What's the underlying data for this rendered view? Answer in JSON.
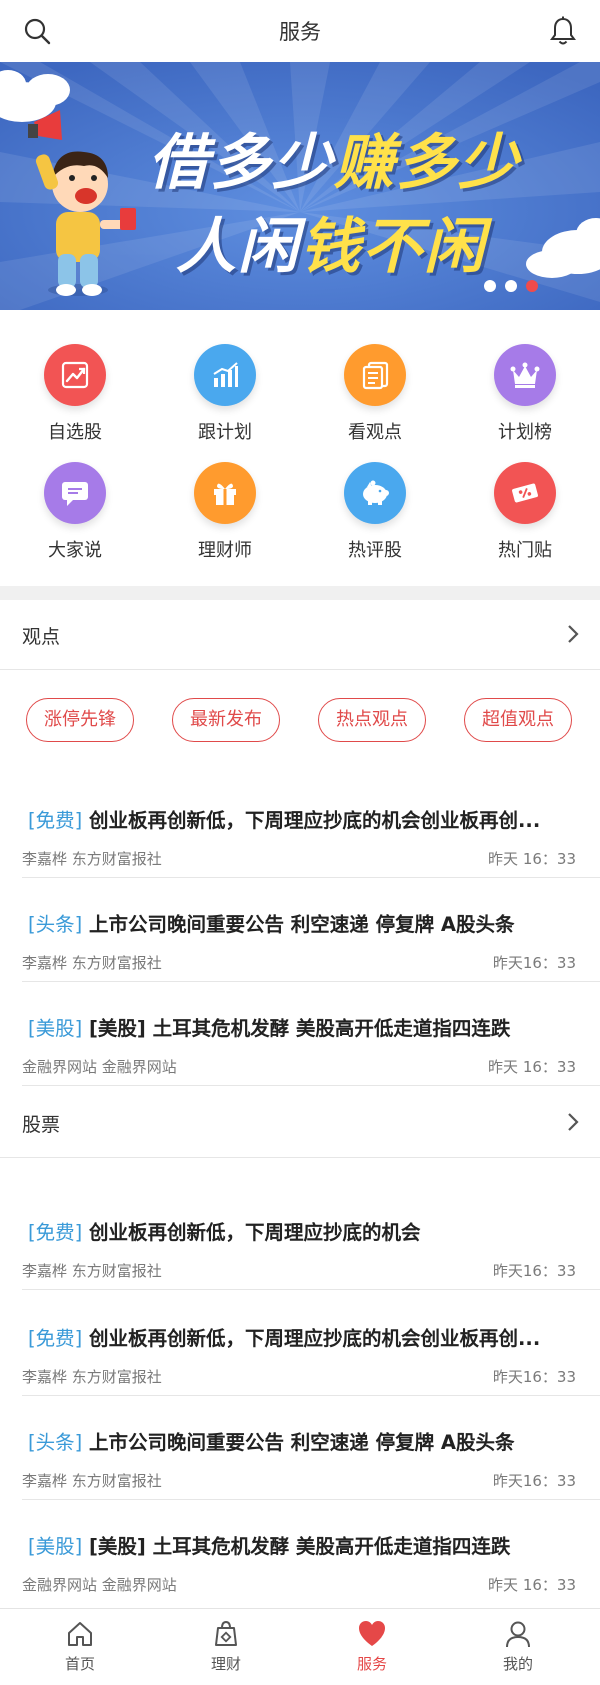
{
  "header": {
    "title": "服务",
    "search_icon": "search-icon",
    "bell_icon": "bell-icon"
  },
  "banner": {
    "line1_white": "借多少",
    "line1_yellow": "赚多少",
    "line2_white": "人闲",
    "line2_yellow": "钱不闲",
    "dots_count": 3,
    "active_dot": 3
  },
  "grid": [
    {
      "label": "自选股",
      "icon": "stock-chart-icon",
      "color": "#f25454"
    },
    {
      "label": "跟计划",
      "icon": "bar-chart-icon",
      "color": "#4aa8ee"
    },
    {
      "label": "看观点",
      "icon": "document-icon",
      "color": "#ff9b2e"
    },
    {
      "label": "计划榜",
      "icon": "crown-icon",
      "color": "#a67be8"
    },
    {
      "label": "大家说",
      "icon": "chat-icon",
      "color": "#a67be8"
    },
    {
      "label": "理财师",
      "icon": "gift-icon",
      "color": "#ff9b2e"
    },
    {
      "label": "热评股",
      "icon": "piggy-bank-icon",
      "color": "#4aa8ee"
    },
    {
      "label": "热门贴",
      "icon": "coupon-icon",
      "color": "#f25454"
    }
  ],
  "sections": {
    "viewpoint_title": "观点",
    "stock_title": "股票"
  },
  "tags": [
    "涨停先锋",
    "最新发布",
    "热点观点",
    "超值观点"
  ],
  "viewpoint_news": [
    {
      "tag": "[免费]",
      "title": " 创业板再创新低，下周理应抄底的机会创业板再创...",
      "source": "李嘉桦 东方财富报社",
      "time": "昨天 16：33"
    },
    {
      "tag": "[头条]",
      "title": " 上市公司晚间重要公告 利空速递 停复牌 A股头条",
      "source": "李嘉桦 东方财富报社",
      "time": "昨天16：33"
    },
    {
      "tag": "[美股]",
      "title": " [美股] 土耳其危机发酵 美股高开低走道指四连跌",
      "source": "金融界网站 金融界网站",
      "time": "昨天 16：33"
    }
  ],
  "stock_news": [
    {
      "tag": "[免费]",
      "title": " 创业板再创新低，下周理应抄底的机会",
      "source": "李嘉桦 东方财富报社",
      "time": "昨天16：33"
    },
    {
      "tag": "[免费]",
      "title": " 创业板再创新低，下周理应抄底的机会创业板再创...",
      "source": "李嘉桦 东方财富报社",
      "time": "昨天16：33"
    },
    {
      "tag": "[头条]",
      "title": " 上市公司晚间重要公告 利空速递 停复牌 A股头条",
      "source": "李嘉桦 东方财富报社",
      "time": "昨天16：33"
    },
    {
      "tag": "[美股]",
      "title": " [美股] 土耳其危机发酵 美股高开低走道指四连跌",
      "source": "金融界网站 金融界网站",
      "time": "昨天 16：33"
    }
  ],
  "tabbar": [
    {
      "label": "首页",
      "icon": "home-icon"
    },
    {
      "label": "理财",
      "icon": "wallet-icon"
    },
    {
      "label": "服务",
      "icon": "heart-icon",
      "active": true
    },
    {
      "label": "我的",
      "icon": "user-icon"
    }
  ],
  "colors": {
    "accent": "#e54848",
    "tag_blue": "#3a9ad8",
    "banner_blue": "#4a78d0",
    "banner_yellow": "#ffe14a"
  }
}
